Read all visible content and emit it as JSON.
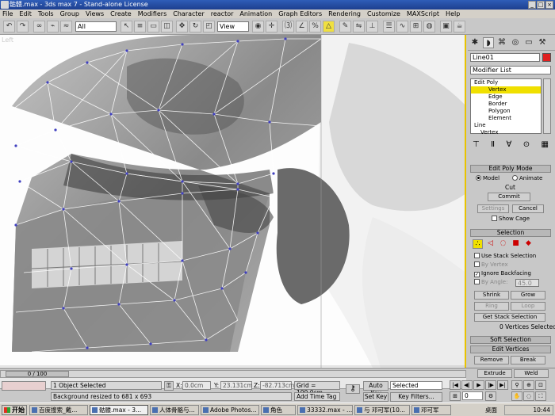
{
  "window": {
    "title": "骷髅.max - 3ds max 7 - Stand-alone License"
  },
  "menu": [
    "File",
    "Edit",
    "Tools",
    "Group",
    "Views",
    "Create",
    "Modifiers",
    "Character",
    "reactor",
    "Animation",
    "Graph Editors",
    "Rendering",
    "Customize",
    "MAXScript",
    "Help"
  ],
  "toolbar": {
    "selection_filter": "All",
    "coord_system": "View"
  },
  "viewport": {
    "label": "Left",
    "accent_color": "#e8c300"
  },
  "command_panel": {
    "object_name": "Line01",
    "object_color": "#e02020",
    "modifier_list": "Modifier List",
    "stack": [
      {
        "label": "Edit Poly",
        "level": 0,
        "selected": false
      },
      {
        "label": "Vertex",
        "level": 1,
        "selected": true
      },
      {
        "label": "Edge",
        "level": 1,
        "selected": false
      },
      {
        "label": "Border",
        "level": 1,
        "selected": false
      },
      {
        "label": "Polygon",
        "level": 1,
        "selected": false
      },
      {
        "label": "Element",
        "level": 1,
        "selected": false
      },
      {
        "label": "Line",
        "level": 0,
        "selected": false
      },
      {
        "label": "Vertex",
        "level": 1,
        "selected": false
      }
    ],
    "edit_poly_mode": {
      "header": "Edit Poly Mode",
      "model": "Model",
      "animate": "Animate",
      "cut": "Cut",
      "commit": "Commit",
      "settings": "Settings",
      "cancel": "Cancel",
      "show_cage": "Show Cage"
    },
    "selection": {
      "header": "Selection",
      "use_stack": "Use Stack Selection",
      "by_vertex": "By Vertex",
      "ignore_backfacing": "Ignore Backfacing",
      "by_angle": "By Angle:",
      "by_angle_value": "45.0",
      "shrink": "Shrink",
      "grow": "Grow",
      "ring": "Ring",
      "loop": "Loop",
      "get_stack": "Get Stack Selection",
      "status": "0 Vertices Selected"
    },
    "soft_selection": {
      "header": "Soft Selection"
    },
    "edit_vertices": {
      "header": "Edit Vertices",
      "remove": "Remove",
      "break": "Break",
      "extrude": "Extrude",
      "weld": "Weld"
    }
  },
  "status": {
    "time": "0 / 100",
    "objects_selected": "1 Object Selected",
    "prompt": "Background resized to 681 x 693",
    "x_value": "0.0cm",
    "y_value": "23.131cm",
    "z_value": "-82.713cm",
    "grid": "Grid = 100.0cm",
    "add_time_tag": "Add Time Tag",
    "auto_key": "Auto Key",
    "set_key": "Set Key",
    "key_mode": "Selected",
    "key_filters": "Key Filters...",
    "frame": "0"
  },
  "taskbar": {
    "start": "开始",
    "items": [
      "百度搜索_戴...",
      "骷髅.max - 3...",
      "人体骨骼与...",
      "Adobe Photos...",
      "角色",
      "33332.max - ...",
      "与 邓可军(10...",
      "邓可军"
    ],
    "active_index": 1,
    "tray_label": "桌面",
    "clock": "10:44"
  }
}
